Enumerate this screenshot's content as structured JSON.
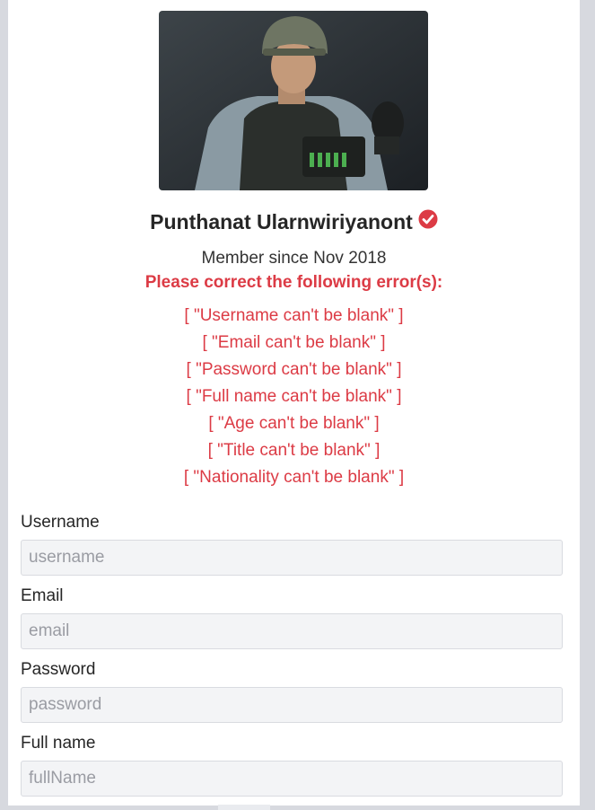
{
  "profile": {
    "name": "Punthanat Ularnwiriyanont",
    "member_since": "Member since Nov 2018",
    "verified_icon": "check-circle-icon"
  },
  "errors": {
    "title": "Please correct the following error(s):",
    "items": [
      "[ \"Username can't be blank\" ]",
      "[ \"Email can't be blank\" ]",
      "[ \"Password can't be blank\" ]",
      "[ \"Full name can't be blank\" ]",
      "[ \"Age can't be blank\" ]",
      "[ \"Title can't be blank\" ]",
      "[ \"Nationality can't be blank\" ]"
    ]
  },
  "form": {
    "username": {
      "label": "Username",
      "placeholder": "username",
      "value": ""
    },
    "email": {
      "label": "Email",
      "placeholder": "email",
      "value": ""
    },
    "password": {
      "label": "Password",
      "placeholder": "password",
      "value": ""
    },
    "fullname": {
      "label": "Full name",
      "placeholder": "fullName",
      "value": ""
    }
  },
  "colors": {
    "error": "#dc3b45",
    "background": "#d7d9df",
    "card": "#ffffff"
  }
}
